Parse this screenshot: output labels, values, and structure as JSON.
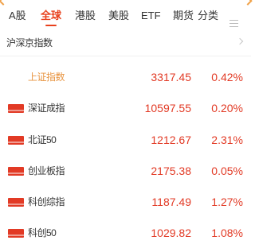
{
  "tabs": [
    {
      "label": "A股",
      "active": false
    },
    {
      "label": "全球",
      "active": true
    },
    {
      "label": "港股",
      "active": false
    },
    {
      "label": "美股",
      "active": false
    },
    {
      "label": "ETF",
      "active": false
    },
    {
      "label": "期货",
      "active": false
    },
    {
      "label": "分类",
      "active": false
    }
  ],
  "section": {
    "title": "沪深京指数"
  },
  "rows": [
    {
      "flag": "none",
      "name": "上证指数",
      "price": "3317.45",
      "change_pct": "0.42%"
    },
    {
      "flag": "red",
      "name": "深证成指",
      "price": "10597.55",
      "change_pct": "0.20%"
    },
    {
      "flag": "red",
      "name": "北证50",
      "price": "1212.67",
      "change_pct": "2.31%"
    },
    {
      "flag": "red",
      "name": "创业板指",
      "price": "2175.38",
      "change_pct": "0.05%"
    },
    {
      "flag": "red",
      "name": "科创综指",
      "price": "1187.49",
      "change_pct": "1.27%"
    },
    {
      "flag": "red",
      "name": "科创50",
      "price": "1029.82",
      "change_pct": "1.08%"
    }
  ],
  "colors": {
    "accent": "#e8401c",
    "rise": "#e23a25",
    "highlight_name": "#e89440"
  },
  "icons": {
    "menu": "menu-icon",
    "arrow": "chevron-right-icon"
  }
}
